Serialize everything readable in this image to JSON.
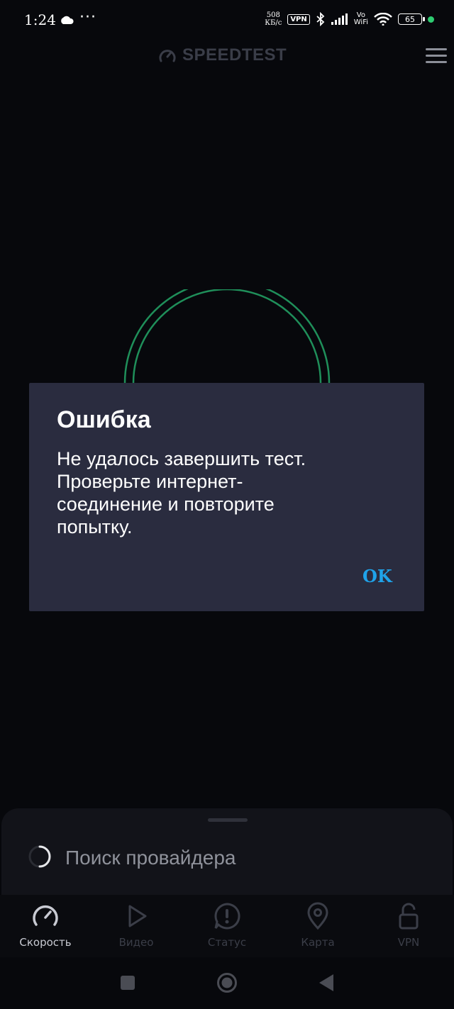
{
  "statusbar": {
    "time": "1:24",
    "dots": "···",
    "net_speed_value": "508",
    "net_speed_unit": "КБ/с",
    "vpn": "VPN",
    "vo": "Vo",
    "wifi": "WiFi",
    "battery": "65"
  },
  "header": {
    "brand": "SPEEDTEST"
  },
  "dialog": {
    "title": "Ошибка",
    "message": "Не удалось завершить тест. Проверьте интернет-соединение и повторите попытку.",
    "ok_label": "OK"
  },
  "provider": {
    "status": "Поиск провайдера"
  },
  "tabs": [
    {
      "label": "Скорость",
      "icon": "speedometer-icon",
      "active": true
    },
    {
      "label": "Видео",
      "icon": "play-icon",
      "active": false
    },
    {
      "label": "Статус",
      "icon": "alert-icon",
      "active": false
    },
    {
      "label": "Карта",
      "icon": "map-pin-icon",
      "active": false
    },
    {
      "label": "VPN",
      "icon": "unlock-icon",
      "active": false
    }
  ],
  "colors": {
    "background": "#07080c",
    "dialog": "#2a2c3f",
    "accent": "#1fa3ea",
    "gauge": "#1f8f5a"
  }
}
